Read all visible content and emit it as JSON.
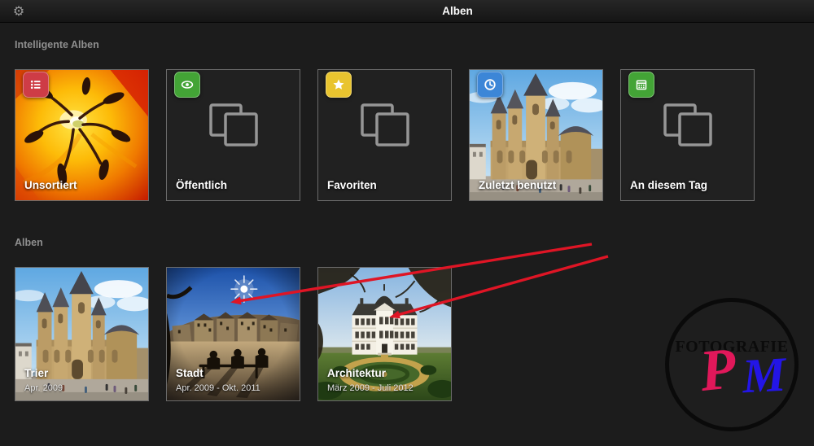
{
  "titlebar": {
    "title": "Alben"
  },
  "icons": {
    "gear": "⚙"
  },
  "sections": {
    "smart": {
      "heading": "Intelligente Alben",
      "items": [
        {
          "label": "Unsortiert",
          "badge_icon": "list-icon",
          "badge_color": "#ce3c46",
          "thumbnail": "flower-macro"
        },
        {
          "label": "Öffentlich",
          "badge_icon": "eye-icon",
          "badge_color": "#43a436",
          "thumbnail": "placeholder-stacked-photos"
        },
        {
          "label": "Favoriten",
          "badge_icon": "star-icon",
          "badge_color": "#e9c42f",
          "thumbnail": "placeholder-stacked-photos"
        },
        {
          "label": "Zuletzt benutzt",
          "badge_icon": "clock-icon",
          "badge_color": "#3c86d7",
          "thumbnail": "trier-cathedral"
        },
        {
          "label": "An diesem Tag",
          "badge_icon": "calendar-icon",
          "badge_color": "#43a436",
          "thumbnail": "placeholder-stacked-photos"
        }
      ]
    },
    "albums": {
      "heading": "Alben",
      "items": [
        {
          "label": "Trier",
          "subtitle": "Apr. 2009",
          "thumbnail": "trier-cathedral"
        },
        {
          "label": "Stadt",
          "subtitle": "Apr. 2009 - Okt. 2011",
          "thumbnail": "city-square-fisheye"
        },
        {
          "label": "Architektur",
          "subtitle": "März 2009 - Juli 2012",
          "thumbnail": "baroque-palace-garden"
        }
      ]
    }
  },
  "annotation": {
    "arrow_color": "#df1525"
  },
  "watermark": {
    "title": "FOTOGRAFIE",
    "initial_p": "P",
    "initial_m": "M",
    "p_color": "#e0185a",
    "m_color": "#2315e6"
  }
}
